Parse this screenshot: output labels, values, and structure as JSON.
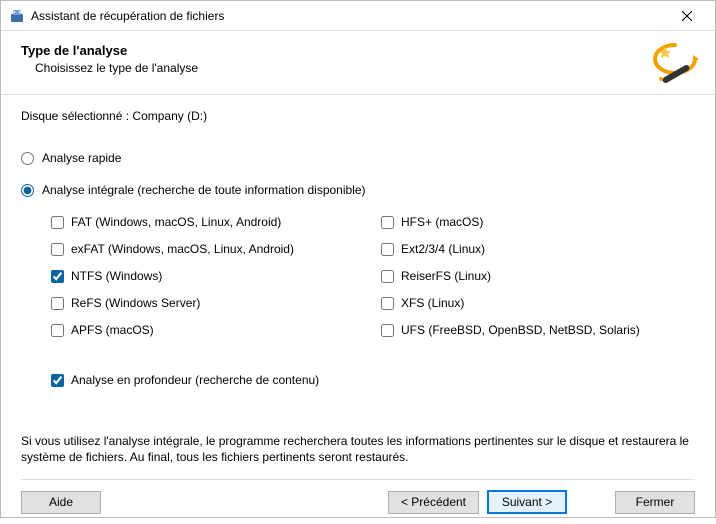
{
  "window": {
    "title": "Assistant de récupération de fichiers"
  },
  "header": {
    "title": "Type de l'analyse",
    "subtitle": "Choisissez le type de l'analyse"
  },
  "selected_disk_label": "Disque sélectionné : Company (D:)",
  "scan_type": {
    "quick": "Analyse rapide",
    "full": "Analyse intégrale (recherche de toute information disponible)",
    "selected": "full"
  },
  "filesystems": {
    "left": [
      {
        "key": "fat",
        "label": "FAT (Windows, macOS, Linux, Android)",
        "checked": false
      },
      {
        "key": "exfat",
        "label": "exFAT (Windows, macOS, Linux, Android)",
        "checked": false
      },
      {
        "key": "ntfs",
        "label": "NTFS (Windows)",
        "checked": true
      },
      {
        "key": "refs",
        "label": "ReFS (Windows Server)",
        "checked": false
      },
      {
        "key": "apfs",
        "label": "APFS (macOS)",
        "checked": false
      }
    ],
    "right": [
      {
        "key": "hfs",
        "label": "HFS+ (macOS)",
        "checked": false
      },
      {
        "key": "ext",
        "label": "Ext2/3/4 (Linux)",
        "checked": false
      },
      {
        "key": "reiser",
        "label": "ReiserFS (Linux)",
        "checked": false
      },
      {
        "key": "xfs",
        "label": "XFS (Linux)",
        "checked": false
      },
      {
        "key": "ufs",
        "label": "UFS (FreeBSD, OpenBSD, NetBSD, Solaris)",
        "checked": false
      }
    ]
  },
  "deep_scan": {
    "label": "Analyse en profondeur (recherche de contenu)",
    "checked": true
  },
  "note": "Si vous utilisez l'analyse intégrale, le programme recherchera toutes les informations pertinentes sur le disque et restaurera le système de fichiers. Au final, tous les fichiers pertinents seront restaurés.",
  "buttons": {
    "help": "Aide",
    "back": "< Précédent",
    "next": "Suivant >",
    "close": "Fermer"
  }
}
